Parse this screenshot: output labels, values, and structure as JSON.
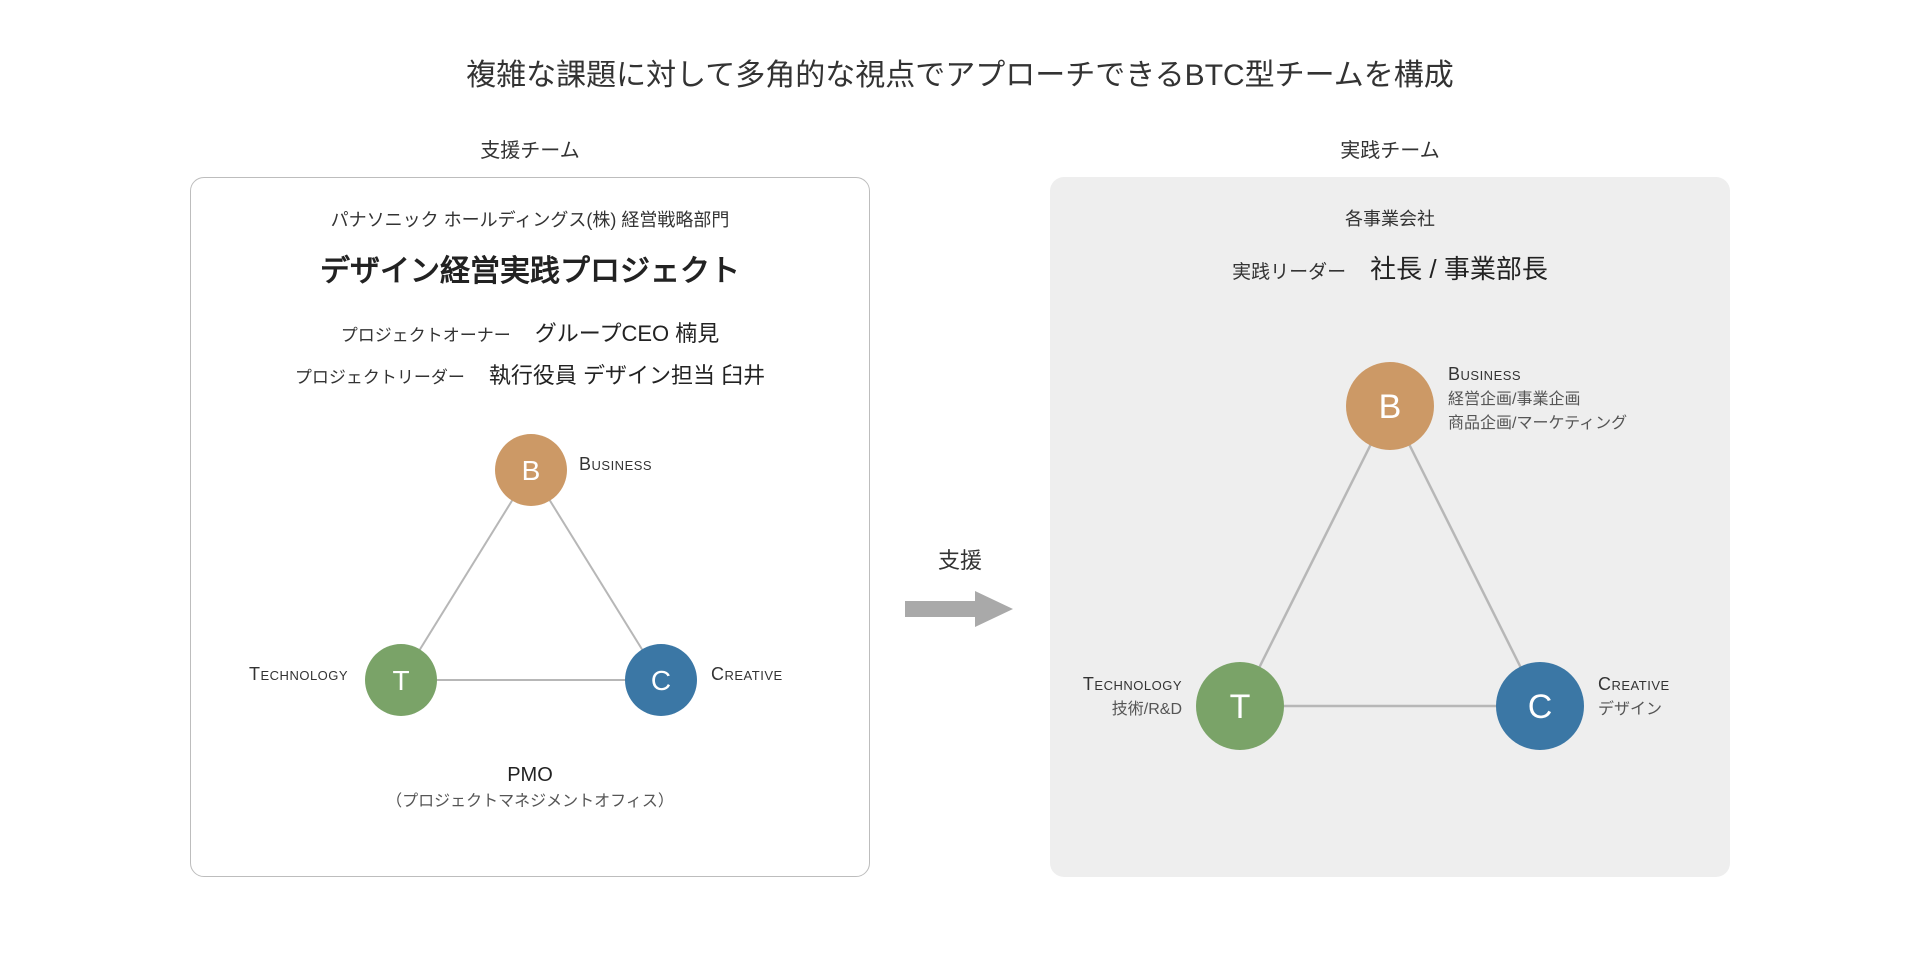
{
  "title": "複雑な課題に対して多角的な視点でアプローチできるBTC型チームを構成",
  "arrow_label": "支援",
  "left": {
    "col_label": "支援チーム",
    "org": "パナソニック ホールディングス(株) 経営戦略部門",
    "project_title": "デザイン経営実践プロジェクト",
    "owner_label": "プロジェクトオーナー",
    "owner_value": "グループCEO 楠見",
    "leader_label": "プロジェクトリーダー",
    "leader_value": "執行役員 デザイン担当 臼井",
    "nodes": {
      "b": {
        "letter": "B",
        "title": "Business"
      },
      "t": {
        "letter": "T",
        "title": "Technology"
      },
      "c": {
        "letter": "C",
        "title": "Creative"
      }
    },
    "pmo_title": "PMO",
    "pmo_sub": "（プロジェクトマネジメントオフィス）"
  },
  "right": {
    "col_label": "実践チーム",
    "org": "各事業会社",
    "leader_label": "実践リーダー",
    "leader_value": "社長 / 事業部長",
    "nodes": {
      "b": {
        "letter": "B",
        "title": "Business",
        "sub1": "経営企画/事業企画",
        "sub2": "商品企画/マーケティング"
      },
      "t": {
        "letter": "T",
        "title": "Technology",
        "sub1": "技術/R&D"
      },
      "c": {
        "letter": "C",
        "title": "Creative",
        "sub1": "デザイン"
      }
    }
  },
  "colors": {
    "b": "#cc9966",
    "t": "#7aa368",
    "c": "#3b77a5",
    "edge": "#b7b7b7",
    "arrow": "#a9a9a9"
  }
}
